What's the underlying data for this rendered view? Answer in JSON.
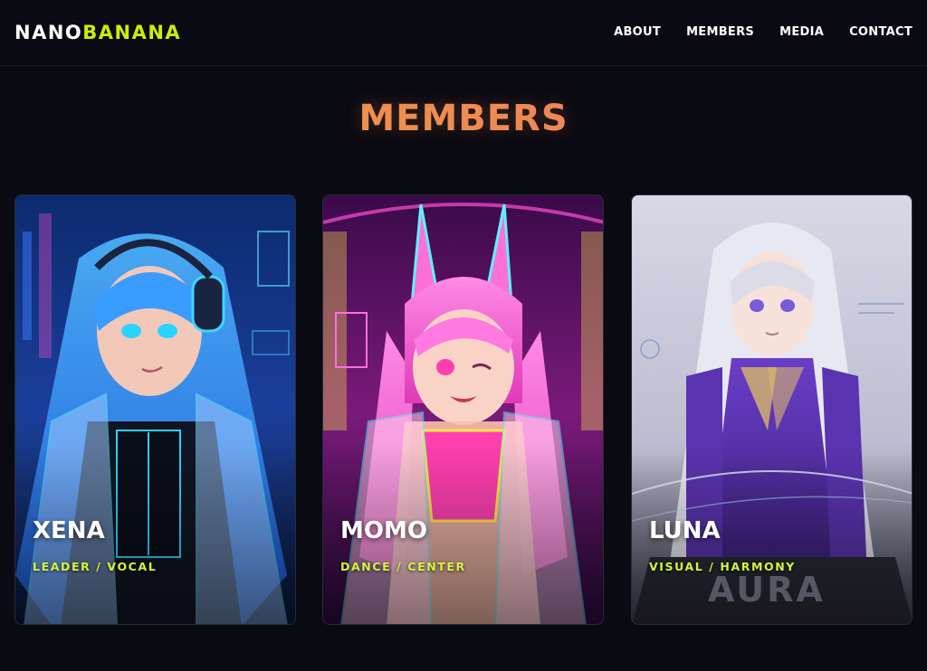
{
  "brand": {
    "part1": "NANO",
    "part2": "BANANA"
  },
  "nav": {
    "items": [
      {
        "label": "ABOUT"
      },
      {
        "label": "MEMBERS"
      },
      {
        "label": "MEDIA"
      },
      {
        "label": "CONTACT"
      }
    ]
  },
  "section": {
    "title": "MEMBERS"
  },
  "members": [
    {
      "name": "XENA",
      "role": "LEADER / VOCAL",
      "theme_color": "#2aa8ff"
    },
    {
      "name": "MOMO",
      "role": "DANCE / CENTER",
      "theme_color": "#ff4fd0"
    },
    {
      "name": "LUNA",
      "role": "VISUAL / HARMONY",
      "theme_color": "#7a4ed8"
    }
  ],
  "luna_card": {
    "backdrop_text": "AURA"
  },
  "colors": {
    "accent": "#c8f000",
    "title_from": "#e8a040",
    "title_to": "#f07a6a",
    "bg": "#0a0a12"
  }
}
